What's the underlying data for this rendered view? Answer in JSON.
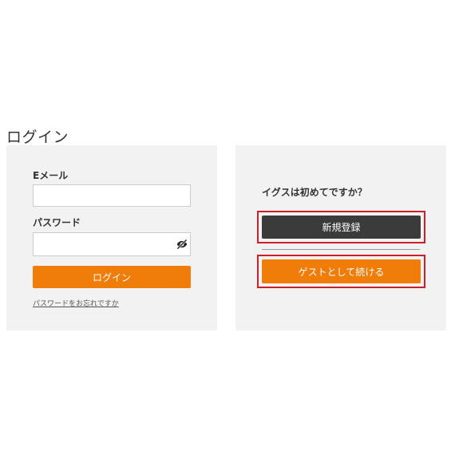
{
  "page": {
    "title": "ログイン"
  },
  "login_panel": {
    "email_label": "Eメール",
    "email_value": "",
    "password_label": "パスワード",
    "password_value": "",
    "password_toggle_icon": "eye-slash-icon",
    "login_button_label": "ログイン",
    "forgot_password_link": "パスワードをお忘れですか"
  },
  "guest_panel": {
    "prompt": "イグスは初めてですか？",
    "register_button_label": "新規登録",
    "guest_button_label": "ゲストとして続ける"
  },
  "colors": {
    "primary_orange": "#f07d0a",
    "dark_button": "#3b3b3b",
    "panel_background": "#f2f2f2",
    "highlight_red": "#cc1f2a"
  }
}
